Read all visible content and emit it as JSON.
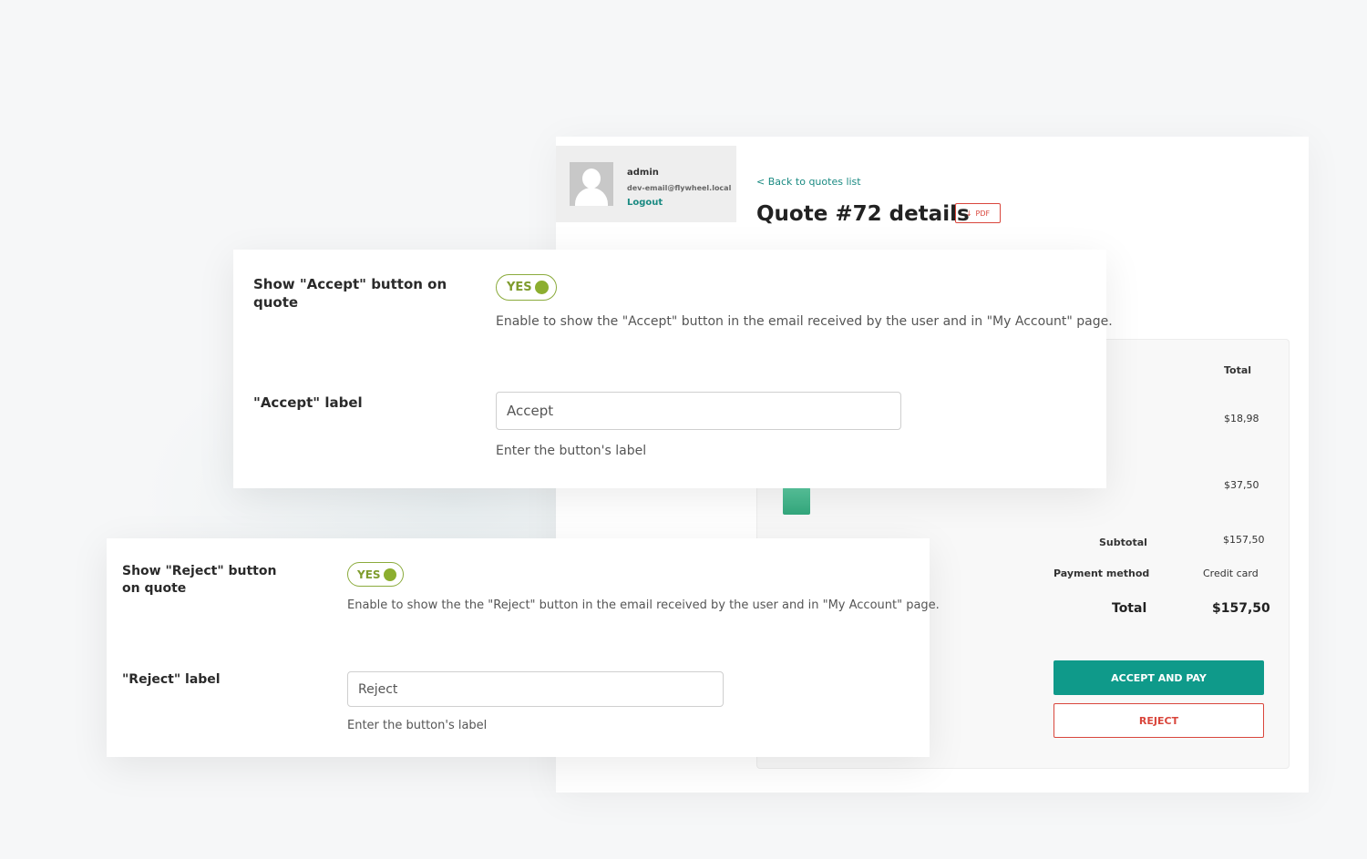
{
  "quote_page": {
    "user": {
      "name": "admin",
      "email": "dev-email@flywheel.local",
      "logout_label": "Logout"
    },
    "back_link": "< Back to quotes list",
    "title": "Quote #72 details",
    "pdf_label": "PDF",
    "totals": {
      "header_total": "Total",
      "line_amounts": [
        "$18,98",
        "$37,50"
      ],
      "subtotal_label": "Subtotal",
      "subtotal_value": "$157,50",
      "payment_method_label": "Payment method",
      "payment_method_value": "Credit card",
      "total_label": "Total",
      "total_value": "$157,50"
    },
    "accept_pay_label": "ACCEPT AND PAY",
    "reject_label": "REJECT"
  },
  "accept_settings": {
    "show_label": "Show \"Accept\" button on quote",
    "toggle_text": "YES",
    "show_description": "Enable to show the \"Accept\" button in the email received by the user and in \"My Account\" page.",
    "label_field_label": "\"Accept\" label",
    "label_value": "Accept",
    "label_hint": "Enter the button's label"
  },
  "reject_settings": {
    "show_label": "Show \"Reject\" button on quote",
    "toggle_text": "YES",
    "show_description": "Enable to show the the \"Reject\" button in the email received by the user and in \"My Account\" page.",
    "label_field_label": "\"Reject\" label",
    "label_value": "Reject",
    "label_hint": "Enter the button's label"
  },
  "colors": {
    "accent": "#0f9a8a",
    "reject": "#d9463c",
    "toggle": "#8cae2f"
  }
}
